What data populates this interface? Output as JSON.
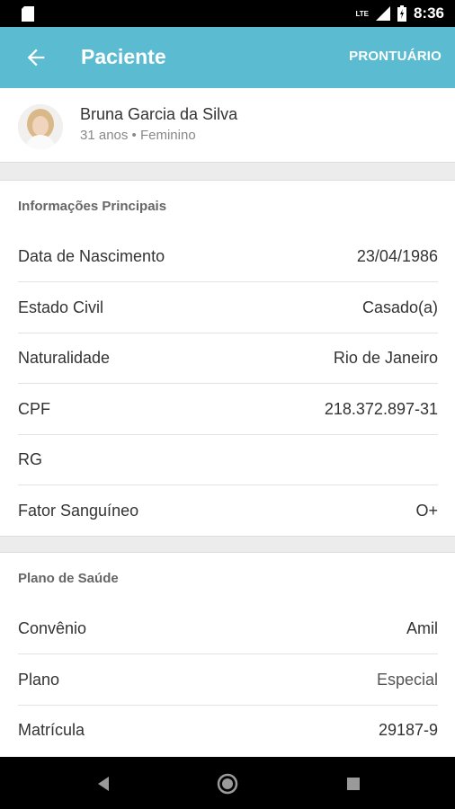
{
  "status_bar": {
    "time": "8:36",
    "network_label": "LTE"
  },
  "app_bar": {
    "title": "Paciente",
    "action_label": "PRONTUÁRIO"
  },
  "patient": {
    "name": "Bruna Garcia da Silva",
    "meta": "31 anos • Feminino"
  },
  "main_info": {
    "title": "Informações Principais",
    "rows": [
      {
        "label": "Data de Nascimento",
        "value": "23/04/1986"
      },
      {
        "label": "Estado Civil",
        "value": "Casado(a)"
      },
      {
        "label": "Naturalidade",
        "value": "Rio de Janeiro"
      },
      {
        "label": "CPF",
        "value": "218.372.897-31"
      },
      {
        "label": "RG",
        "value": ""
      },
      {
        "label": "Fator Sanguíneo",
        "value": "O+"
      }
    ]
  },
  "health_plan": {
    "title": "Plano de Saúde",
    "rows": [
      {
        "label": "Convênio",
        "value": "Amil"
      },
      {
        "label": "Plano",
        "value": "Especial"
      },
      {
        "label": "Matrícula",
        "value": "29187-9"
      }
    ]
  },
  "colors": {
    "app_bar": "#5bbcd1",
    "background": "#ececec"
  }
}
